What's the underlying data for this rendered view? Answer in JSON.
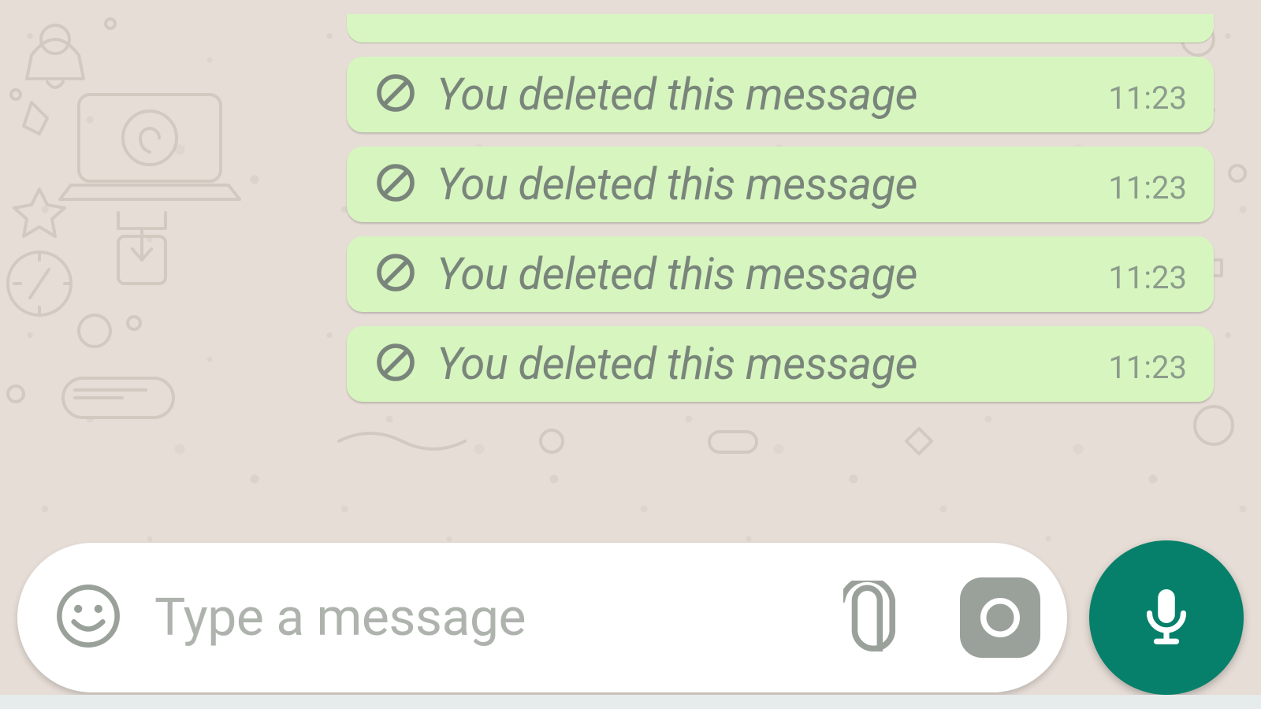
{
  "messages": [
    {
      "text": "You deleted this message",
      "time": "11:23",
      "icon": "prohibited-icon"
    },
    {
      "text": "You deleted this message",
      "time": "11:23",
      "icon": "prohibited-icon"
    },
    {
      "text": "You deleted this message",
      "time": "11:23",
      "icon": "prohibited-icon"
    },
    {
      "text": "You deleted this message",
      "time": "11:23",
      "icon": "prohibited-icon"
    }
  ],
  "composer": {
    "placeholder": "Type a message"
  },
  "colors": {
    "bubble_bg": "#d7f5bf",
    "wallpaper_bg": "#e6ddd6",
    "grey_icon": "#9aa19a",
    "fab_bg": "#06806a",
    "deleted_text": "#79857b",
    "timestamp": "#8c9c8c"
  }
}
